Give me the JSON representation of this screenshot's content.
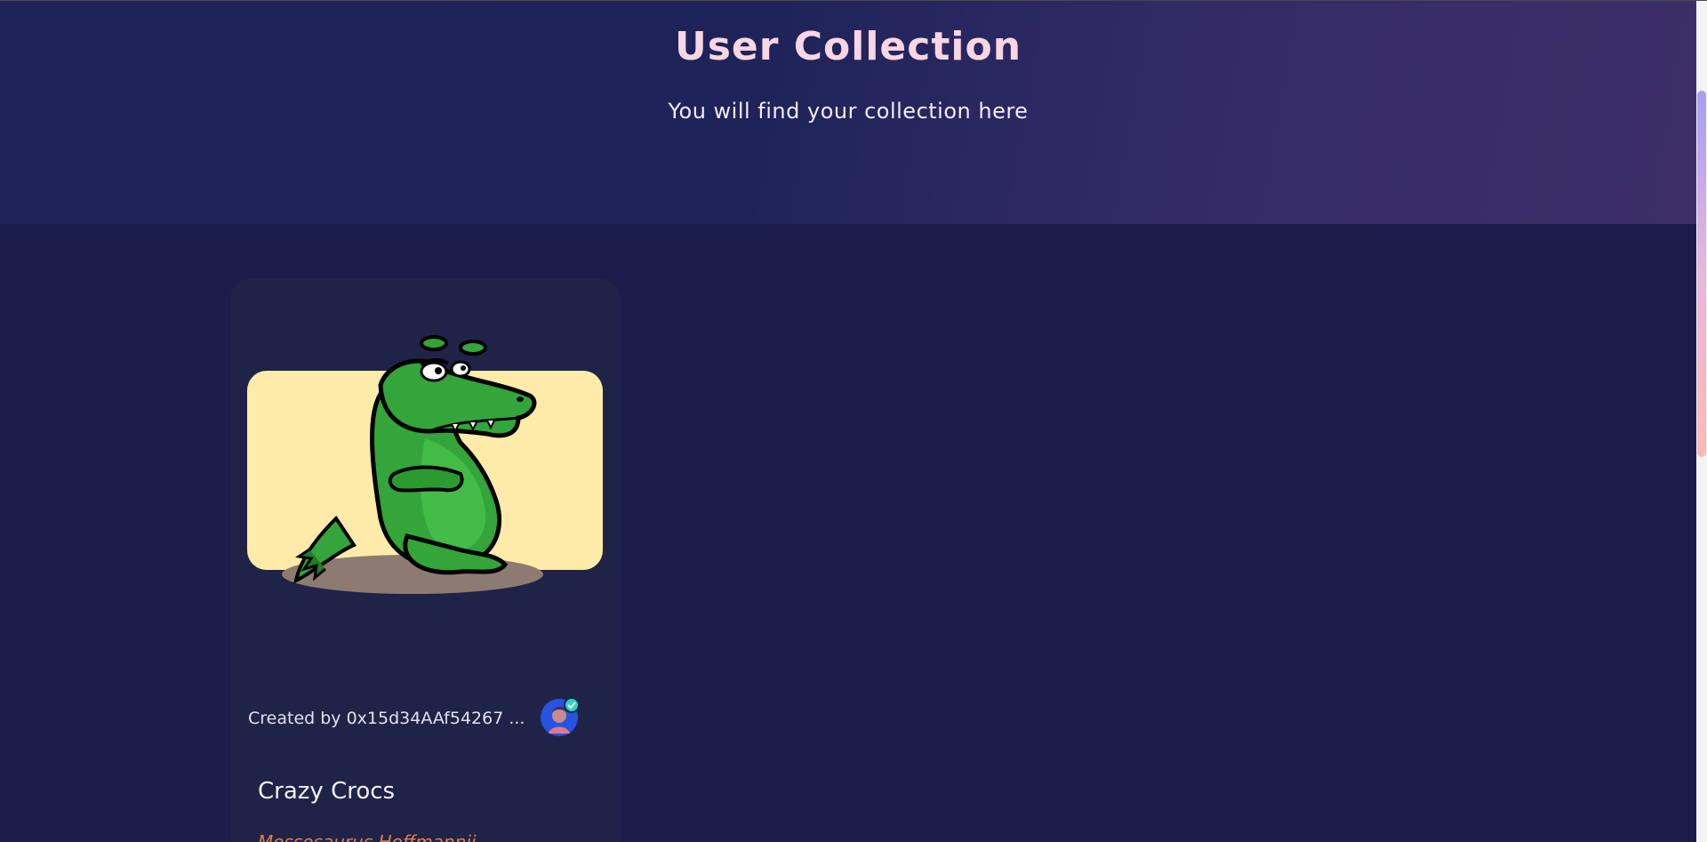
{
  "header": {
    "title": "User Collection",
    "subtitle": "You will find your collection here"
  },
  "collection": {
    "items": [
      {
        "image_icon": "crocodile-illustration",
        "creator_text": "Created by 0x15d34AAf54267 ...",
        "creator_avatar_icon": "verified-avatar",
        "title": "Crazy Crocs",
        "meta_text": "Mossosaurus Hoffmannii"
      }
    ]
  },
  "colors": {
    "hero_title": "#fbd6e2",
    "background": "#1c1c4b",
    "card_bg": "#1f2347",
    "accent_orange": "#e6794c"
  }
}
